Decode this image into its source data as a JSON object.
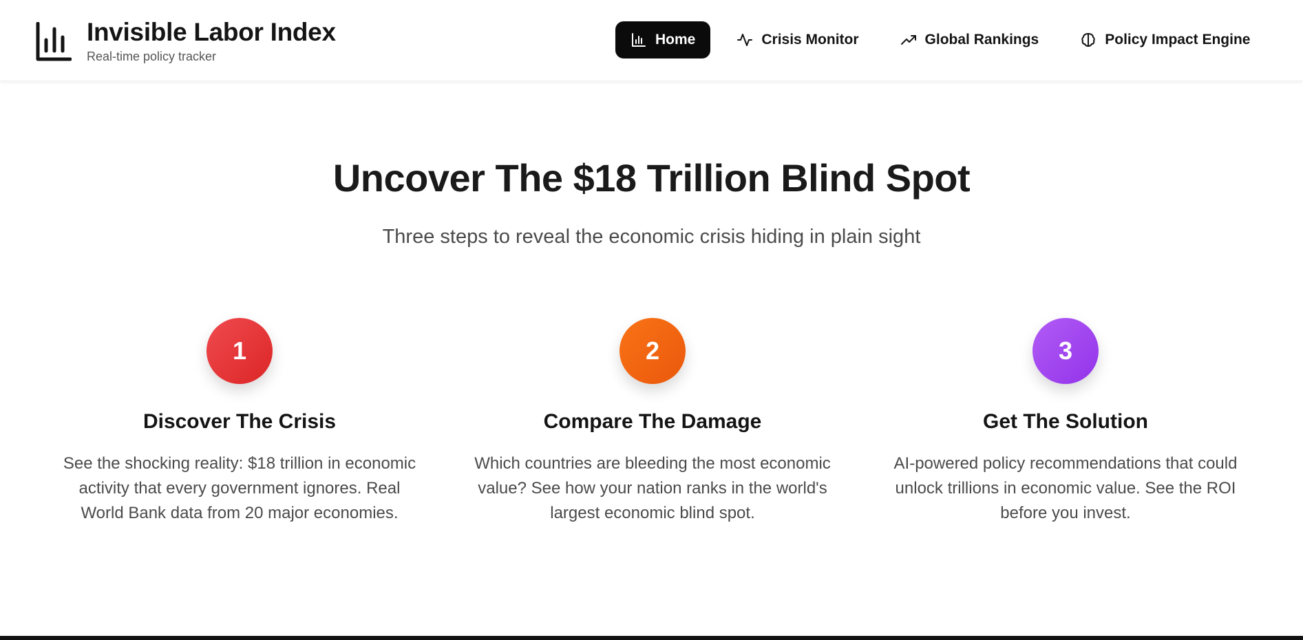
{
  "header": {
    "brand": {
      "icon": "bar-chart-icon",
      "title": "Invisible Labor Index",
      "subtitle": "Real-time policy tracker"
    },
    "nav": [
      {
        "label": "Home",
        "icon": "bar-chart-icon",
        "active": true
      },
      {
        "label": "Crisis Monitor",
        "icon": "activity-icon",
        "active": false
      },
      {
        "label": "Global Rankings",
        "icon": "trending-up-icon",
        "active": false
      },
      {
        "label": "Policy Impact Engine",
        "icon": "brain-icon",
        "active": false
      }
    ]
  },
  "hero": {
    "title": "Uncover The $18 Trillion Blind Spot",
    "subtitle": "Three steps to reveal the economic crisis hiding in plain sight"
  },
  "steps": [
    {
      "number": "1",
      "title": "Discover The Crisis",
      "description": "See the shocking reality: $18 trillion in economic activity that every government ignores. Real World Bank data from 20 major economies.",
      "color": "#e5333b"
    },
    {
      "number": "2",
      "title": "Compare The Damage",
      "description": "Which countries are bleeding the most economic value? See how your nation ranks in the world's largest economic blind spot.",
      "color": "#f06a12"
    },
    {
      "number": "3",
      "title": "Get The Solution",
      "description": "AI-powered policy recommendations that could unlock trillions in economic value. See the ROI before you invest.",
      "color": "#a24ef0"
    }
  ],
  "colors": {
    "active_nav_bg": "#0b0b0b",
    "text_primary": "#141414",
    "text_secondary": "#4a4a4a"
  }
}
